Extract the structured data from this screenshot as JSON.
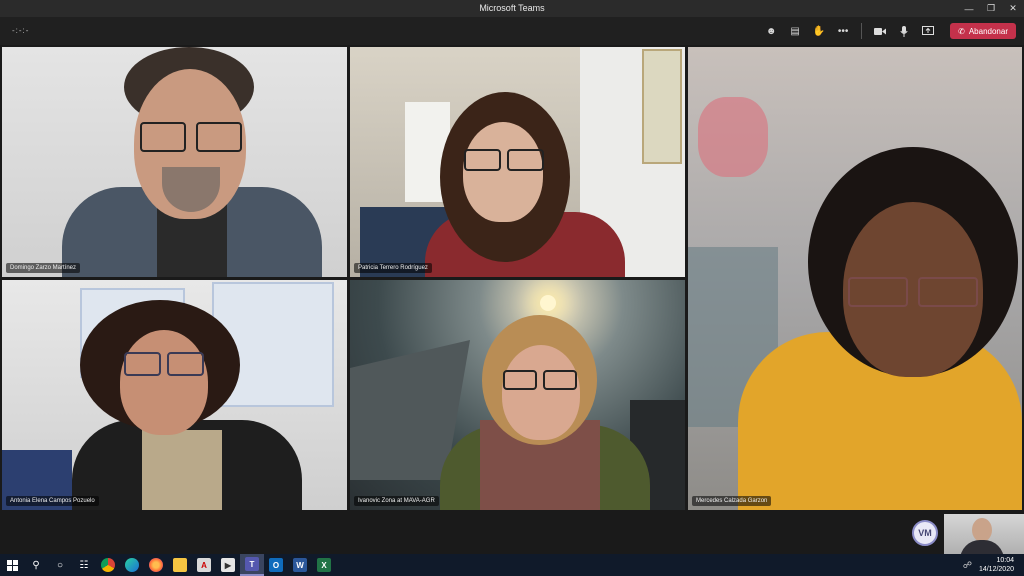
{
  "window": {
    "title": "Microsoft Teams"
  },
  "toolbar": {
    "timer": "-:-:-",
    "leave_label": "Abandonar"
  },
  "participants": [
    {
      "name": "Domingo Zarzo Martínez"
    },
    {
      "name": "Patricia Terrero Rodríguez"
    },
    {
      "name": "Mercedes Calzada Garzon"
    },
    {
      "name": "Antonia Elena Campos Pozuelo"
    },
    {
      "name": "Ivanovic Zona at MAVA-AGR"
    }
  ],
  "overflow": {
    "initials": "VM"
  },
  "taskbar": {
    "time": "10:04",
    "date": "14/12/2020"
  },
  "colors": {
    "leave": "#c4314b",
    "accent": "#8b8cc7",
    "taskbar": "#101a2a"
  }
}
